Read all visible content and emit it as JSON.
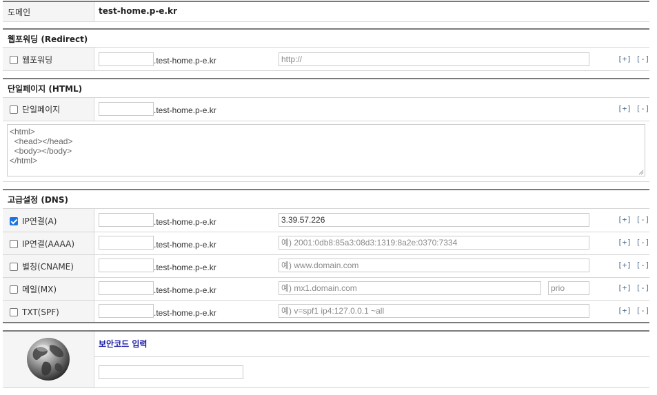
{
  "domain_row": {
    "label": "도메인",
    "value": "test-home.p-e.kr"
  },
  "domain_suffix": ".test-home.p-e.kr",
  "plus_minus": {
    "plus": "[+]",
    "minus": "[-]"
  },
  "redirect_section": {
    "title": "웹포워딩 (Redirect)",
    "row": {
      "label": "웹포워딩",
      "checked": false,
      "sub_value": "",
      "url_placeholder": "http://"
    }
  },
  "html_section": {
    "title": "단일페이지 (HTML)",
    "row": {
      "label": "단일페이지",
      "checked": false,
      "sub_value": ""
    },
    "textarea": "<html>\n  <head></head>\n  <body></body>\n</html>"
  },
  "dns_section": {
    "title": "고급설정 (DNS)",
    "rows": [
      {
        "label": "IP연결(A)",
        "checked": true,
        "sub_value": "",
        "value": "3.39.57.226",
        "placeholder": ""
      },
      {
        "label": "IP연결(AAAA)",
        "checked": false,
        "sub_value": "",
        "value": "",
        "placeholder": "예) 2001:0db8:85a3:08d3:1319:8a2e:0370:7334"
      },
      {
        "label": "별칭(CNAME)",
        "checked": false,
        "sub_value": "",
        "value": "",
        "placeholder": "예) www.domain.com"
      },
      {
        "label": "메일(MX)",
        "checked": false,
        "sub_value": "",
        "value": "",
        "placeholder": "예) mx1.domain.com",
        "prio_placeholder": "prio"
      },
      {
        "label": "TXT(SPF)",
        "checked": false,
        "sub_value": "",
        "value": "",
        "placeholder": "예) v=spf1 ip4:127.0.0.1 ~all"
      }
    ]
  },
  "security": {
    "title": "보안코드 입력",
    "input_value": "",
    "title_color": "#1a1aa6"
  }
}
